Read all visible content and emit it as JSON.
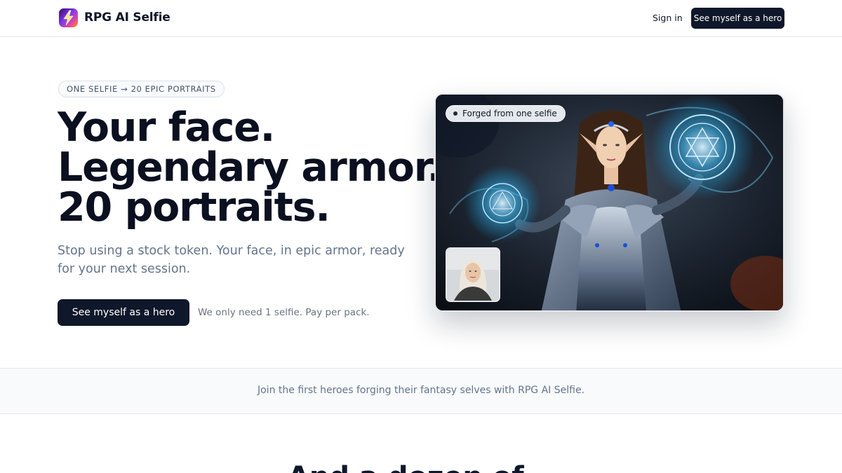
{
  "header": {
    "brand": "RPG AI Selfie",
    "signin_label": "Sign in",
    "cta_label": "See myself as a hero"
  },
  "hero": {
    "pill": "ONE SELFIE → 20 EPIC PORTRAITS",
    "headline": [
      "Your face.",
      "Legendary armor.",
      "20 portraits."
    ],
    "subtitle": "Stop using a stock token. Your face, in epic armor, ready for your next session.",
    "cta_label": "See myself as a hero",
    "cta_note": "We only need 1 selfie. Pay per pack."
  },
  "card": {
    "badge": "Forged from one selfie"
  },
  "strip": {
    "text": "Join the first heroes forging their fantasy selves with RPG AI Selfie."
  },
  "next_section": {
    "heading": "And a dozen of..."
  },
  "colors": {
    "primary": "#0f172a",
    "muted": "#64748b",
    "strip_bg": "#f8fafc",
    "rune_glow": "#7dd3fc"
  },
  "icons": {
    "logo": "lightning-bolt-logo-icon",
    "badge_dot": "dot-icon"
  }
}
